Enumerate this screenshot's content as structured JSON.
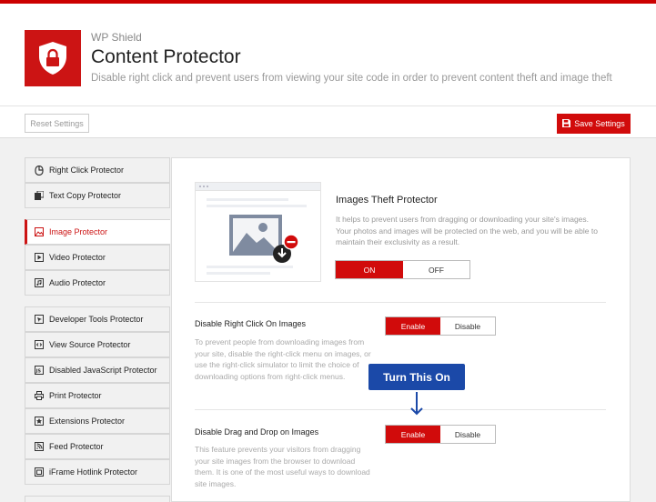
{
  "header": {
    "brand": "WP Shield",
    "title": "Content Protector",
    "subtitle": "Disable right click and prevent users from viewing your site code in order to prevent content theft and image theft"
  },
  "toolbar": {
    "reset_label": "Reset Settings",
    "save_label": "Save Settings"
  },
  "sidebar": {
    "items": [
      {
        "label": "Right Click Protector",
        "icon": "mouse-icon"
      },
      {
        "label": "Text Copy Protector",
        "icon": "copy-icon"
      },
      {
        "label": "Image Protector",
        "icon": "image-icon",
        "active": true
      },
      {
        "label": "Video Protector",
        "icon": "video-icon"
      },
      {
        "label": "Audio Protector",
        "icon": "audio-icon"
      },
      {
        "label": "Developer Tools Protector",
        "icon": "cursor-icon"
      },
      {
        "label": "View Source Protector",
        "icon": "code-icon"
      },
      {
        "label": "Disabled JavaScript Protector",
        "icon": "js-icon"
      },
      {
        "label": "Print Protector",
        "icon": "printer-icon"
      },
      {
        "label": "Extensions Protector",
        "icon": "puzzle-icon"
      },
      {
        "label": "Feed Protector",
        "icon": "rss-icon"
      },
      {
        "label": "iFrame Hotlink Protector",
        "icon": "iframe-icon"
      }
    ]
  },
  "main": {
    "feature_title": "Images Theft Protector",
    "feature_desc": "It helps to prevent users from dragging or downloading your site's images. Your photos and images will be protected on the web, and you will be able to maintain their exclusivity as a result.",
    "feature_toggle": {
      "on": "ON",
      "off": "OFF",
      "selected": "ON"
    },
    "options": [
      {
        "title": "Disable Right Click On Images",
        "desc": "To prevent people from downloading images from your site, disable the right-click menu on images, or use the right-click simulator to limit the choice of downloading options from right-click menus.",
        "enable": "Enable",
        "disable": "Disable",
        "selected": "Enable"
      },
      {
        "title": "Disable Drag and Drop on Images",
        "desc": "This feature prevents your visitors from dragging your site images from the browser to download them. It is one of the most useful ways to download site images.",
        "enable": "Enable",
        "disable": "Disable",
        "selected": "Enable"
      }
    ]
  },
  "callout": {
    "text": "Turn This On"
  },
  "colors": {
    "accent": "#cc1414",
    "callout": "#1b49a8"
  }
}
